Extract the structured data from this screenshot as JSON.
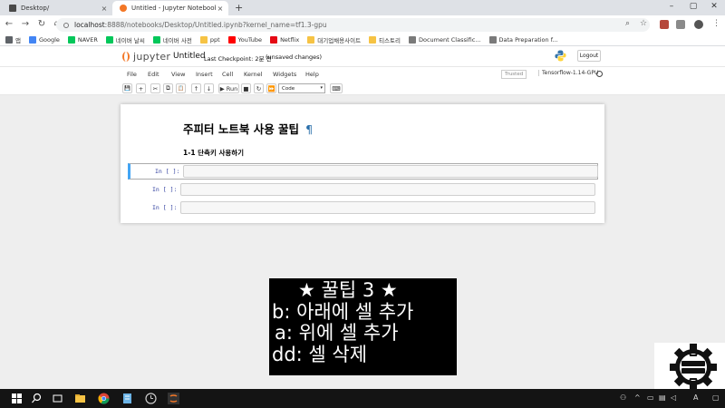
{
  "browser": {
    "tabs": [
      {
        "title": "Desktop/",
        "close": "×"
      },
      {
        "title": "Untitled - Jupyter Notebook",
        "close": "×"
      }
    ],
    "new_tab": "+",
    "window_controls": [
      "–",
      "▢",
      "✕"
    ],
    "address": {
      "host": "localhost",
      "path": ":8888/notebooks/Desktop/Untitled.ipynb?kernel_name=tf1.3-gpu"
    },
    "bookmarks": [
      {
        "label": "앱",
        "icon": "apps-grid-icon",
        "color": "#5f6368"
      },
      {
        "label": "Google",
        "icon": "google-icon",
        "color": "#4285f4"
      },
      {
        "label": "NAVER",
        "icon": "naver-icon",
        "color": "#03c75a"
      },
      {
        "label": "네이버 날씨",
        "icon": "naver-icon",
        "color": "#03c75a"
      },
      {
        "label": "네이버 사전",
        "icon": "naver-icon",
        "color": "#03c75a"
      },
      {
        "label": "ppt",
        "icon": "folder-icon",
        "color": "#f6c344"
      },
      {
        "label": "YouTube",
        "icon": "youtube-icon",
        "color": "#ff0000"
      },
      {
        "label": "Netflix",
        "icon": "netflix-icon",
        "color": "#e50914"
      },
      {
        "label": "대기업채용사이트",
        "icon": "folder-icon",
        "color": "#f6c344"
      },
      {
        "label": "티스토리",
        "icon": "folder-icon",
        "color": "#f6c344"
      },
      {
        "label": "Document Classific...",
        "icon": "doc-icon",
        "color": "#7a7a7a"
      },
      {
        "label": "Data Preparation f...",
        "icon": "doc-icon",
        "color": "#7a7a7a"
      }
    ]
  },
  "jupyter": {
    "logo_text": "jupyter",
    "notebook_name": "Untitled",
    "checkpoint": "Last Checkpoint: 2분 전",
    "save_status": "(unsaved changes)",
    "logout": "Logout",
    "menu": [
      "File",
      "Edit",
      "View",
      "Insert",
      "Cell",
      "Kernel",
      "Widgets",
      "Help"
    ],
    "trusted": "Trusted",
    "kernel_name": "Tensorflow-1.14-GPU",
    "toolbar": {
      "save": "💾",
      "add": "+",
      "cut": "✂",
      "copy": "⧉",
      "paste": "📋",
      "up": "↑",
      "down": "↓",
      "run": "▶ Run",
      "stop": "■",
      "restart": "↻",
      "rerun": "⏩",
      "cell_type": "Code",
      "cell_type_caret": "▾",
      "keyboard": "⌨"
    }
  },
  "notebook": {
    "heading": "주피터 노트북 사용 꿀팁",
    "pilcrow": "¶",
    "subheading": "1-1 단축키 사용하기",
    "cells": [
      {
        "prompt": "In [ ]:"
      },
      {
        "prompt": "In [ ]:"
      },
      {
        "prompt": "In [ ]:"
      }
    ]
  },
  "tip_overlay": {
    "lines": [
      "★ 꿀팁 3 ★",
      "b: 아래에 셀 추가",
      "a: 위에 셀 추가",
      "dd: 셀 삭제"
    ]
  },
  "colors": {
    "jupyter_orange": "#f37726",
    "selected_cell": "#42a5f5",
    "prompt_blue": "#303f9f",
    "taskbar": "#141414"
  }
}
